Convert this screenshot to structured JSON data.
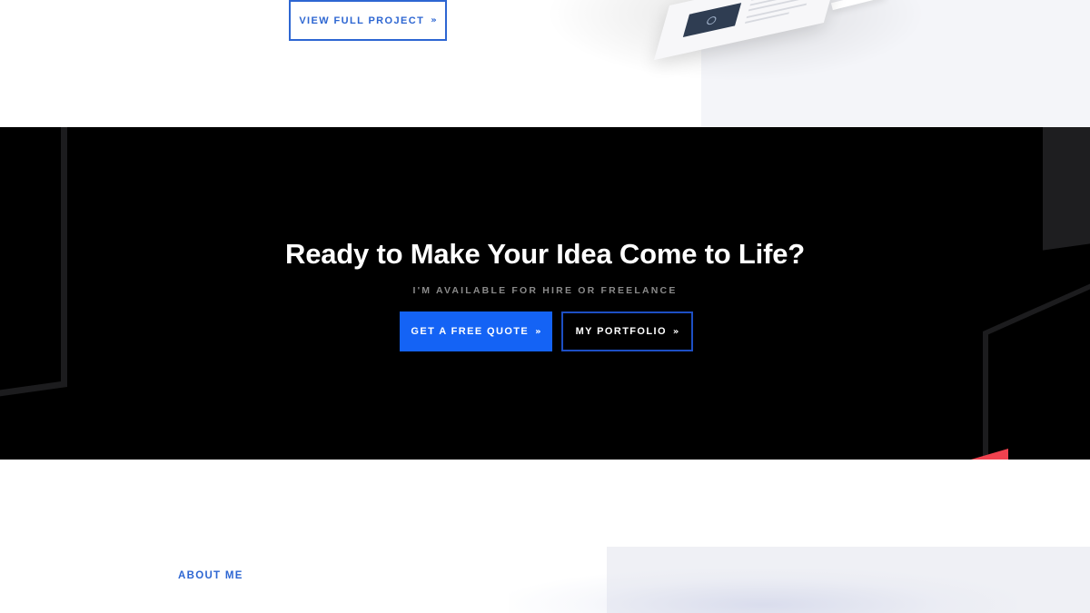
{
  "project_section": {
    "view_project_label": "VIEW FULL PROJECT",
    "chevron": "»"
  },
  "cta": {
    "title": "Ready to Make Your Idea Come to Life?",
    "subtitle": "I'M AVAILABLE FOR HIRE OR FREELANCE",
    "primary_button": {
      "label": "GET A FREE QUOTE",
      "chevron": "»"
    },
    "secondary_button": {
      "label": "MY PORTFOLIO",
      "chevron": "»"
    }
  },
  "about": {
    "label": "ABOUT ME"
  },
  "colors": {
    "accent_blue": "#1463f5",
    "link_blue": "#2d66d2",
    "cta_background": "#000000",
    "accent_red": "#f0424f"
  },
  "icons": {
    "chevron": "double-chevron-right-icon"
  }
}
